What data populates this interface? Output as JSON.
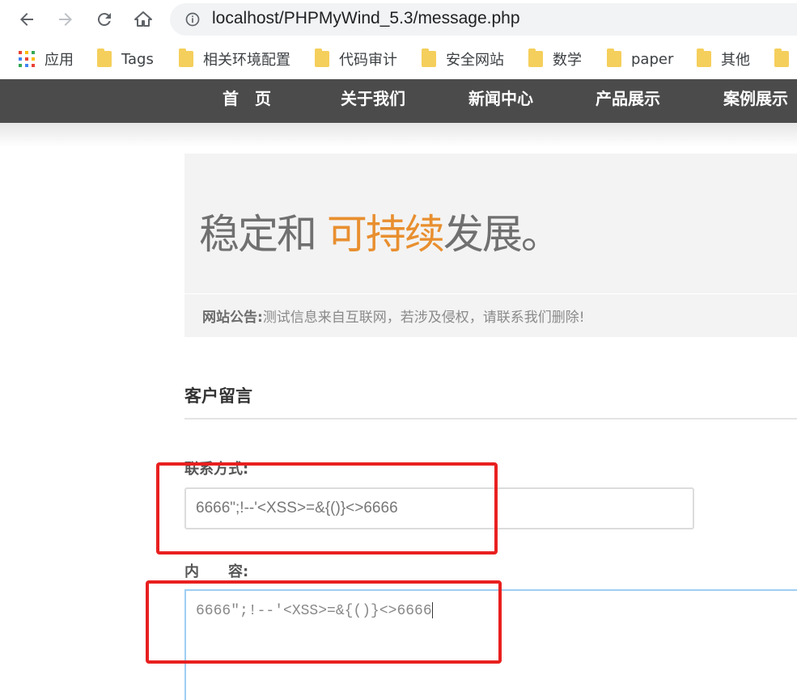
{
  "browser": {
    "url": "localhost/PHPMyWind_5.3/message.php",
    "back_icon": "back-arrow-icon",
    "forward_icon": "forward-arrow-icon",
    "reload_icon": "reload-icon",
    "home_icon": "home-icon",
    "info_icon": "info-icon"
  },
  "bookmarks": [
    {
      "label": "应用",
      "icon": "apps-grid-icon"
    },
    {
      "label": "Tags",
      "icon": "folder-icon"
    },
    {
      "label": "相关环境配置",
      "icon": "folder-icon"
    },
    {
      "label": "代码审计",
      "icon": "folder-icon"
    },
    {
      "label": "安全网站",
      "icon": "folder-icon"
    },
    {
      "label": "数学",
      "icon": "folder-icon"
    },
    {
      "label": "paper",
      "icon": "folder-icon"
    },
    {
      "label": "其他",
      "icon": "folder-icon"
    }
  ],
  "site_nav": [
    "首　页",
    "关于我们",
    "新闻中心",
    "产品展示",
    "案例展示"
  ],
  "banner": {
    "slogan_before": "稳定和 ",
    "slogan_highlight": "可持续",
    "slogan_after": "发展。",
    "notice_label": "网站公告:",
    "notice_text": "测试信息来自互联网，若涉及侵权，请联系我们删除!"
  },
  "form": {
    "title": "客户留言",
    "contact_label": "联系方式:",
    "contact_value": "6666\";!--'<XSS>=&{()}<>6666",
    "content_label": "内　　容:",
    "content_value": "6666\";!--'<XSS>=&{()}<>6666"
  },
  "colors": {
    "nav_bg": "#4b4b4b",
    "highlight": "#e88f2f",
    "annotation_red": "#e8201f",
    "focus_blue": "#9ecdf3"
  }
}
